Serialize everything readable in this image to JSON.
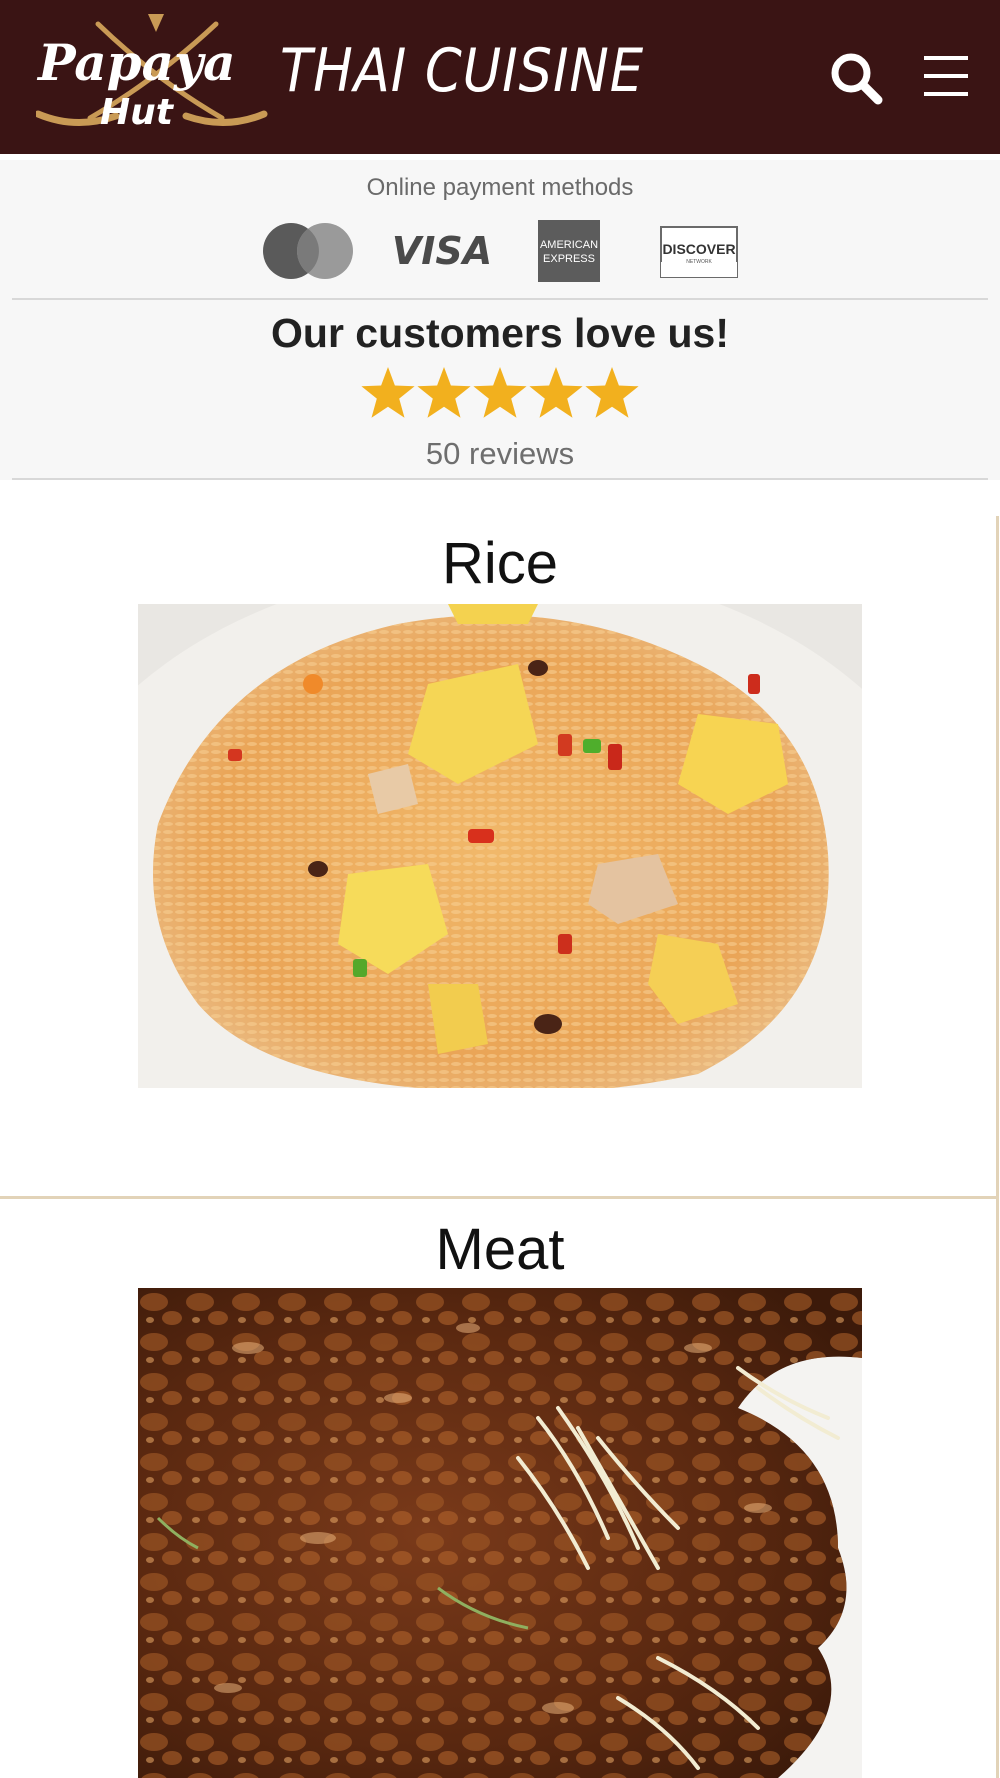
{
  "header": {
    "logo_text_top": "Papaya",
    "logo_text_bottom": "Hut",
    "brand_title": "THAI CUISINE",
    "search_icon": "search-icon",
    "menu_icon": "hamburger-menu-icon",
    "background_color": "#3a1414"
  },
  "payments": {
    "title": "Online payment methods",
    "cards": [
      {
        "name": "mastercard",
        "icon": "mastercard-icon"
      },
      {
        "name": "visa",
        "label": "VISA",
        "icon": "visa-icon"
      },
      {
        "name": "amex",
        "label_top": "AMERICAN",
        "label_bottom": "EXPRESS",
        "icon": "amex-icon"
      },
      {
        "name": "discover",
        "label_top": "DISCOVER",
        "label_bottom": "NETWORK",
        "icon": "discover-icon"
      }
    ]
  },
  "reviews": {
    "title": "Our customers love us!",
    "rating": 5,
    "rating_max": 5,
    "count_label": "50 reviews",
    "star_color": "#f2b01e"
  },
  "categories": [
    {
      "title": "Rice",
      "image": "fried-rice-photo"
    },
    {
      "title": "Meat",
      "image": "glazed-meat-photo"
    }
  ],
  "colors": {
    "accent_rule": "#e2d3b8",
    "panel_background": "#f7f7f7"
  }
}
